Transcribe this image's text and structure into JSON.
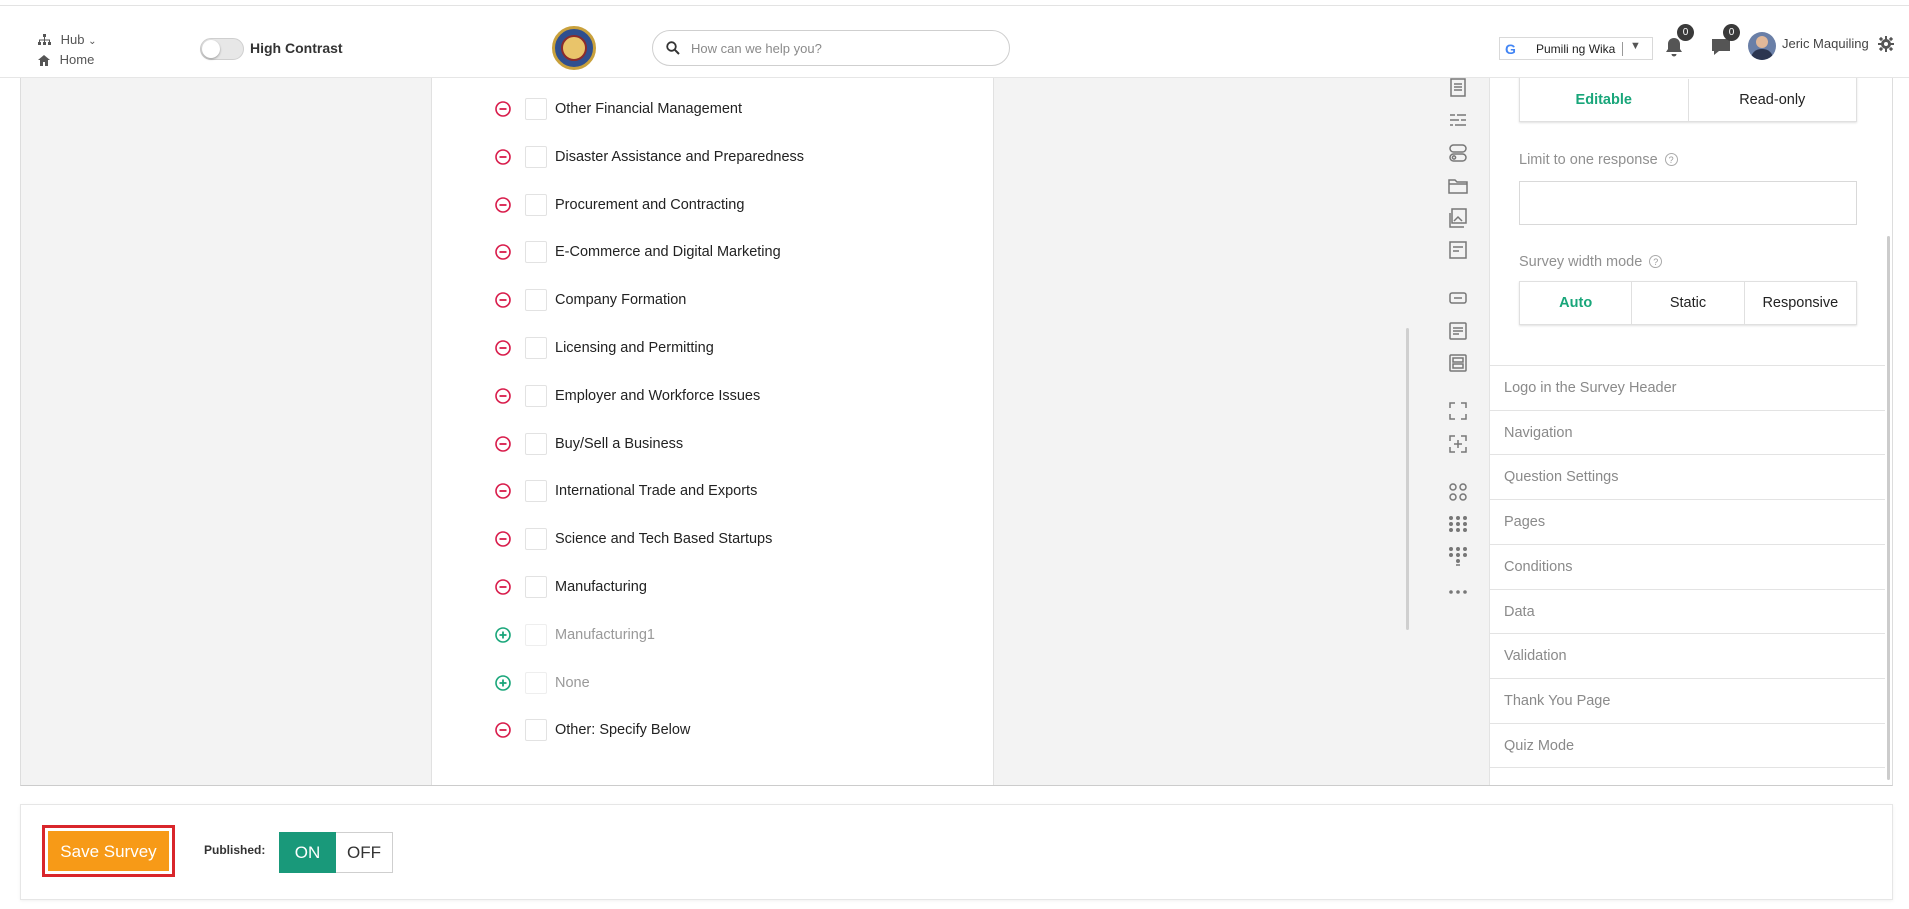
{
  "topbar": {
    "hub_label": "Hub",
    "home_label": "Home",
    "high_contrast_label": "High Contrast",
    "search_placeholder": "How can we help you?",
    "language_label": "Pumili ng Wika",
    "language_arrow": "▼",
    "notifications_count": "0",
    "messages_count": "0",
    "user_name": "Jeric Maquiling"
  },
  "choices": [
    {
      "label": "Other Financial Management",
      "state": "remove"
    },
    {
      "label": "Disaster Assistance and Preparedness",
      "state": "remove"
    },
    {
      "label": "Procurement and Contracting",
      "state": "remove"
    },
    {
      "label": "E-Commerce and Digital Marketing",
      "state": "remove"
    },
    {
      "label": "Company Formation",
      "state": "remove"
    },
    {
      "label": "Licensing and Permitting",
      "state": "remove"
    },
    {
      "label": "Employer and Workforce Issues",
      "state": "remove"
    },
    {
      "label": "Buy/Sell a Business",
      "state": "remove"
    },
    {
      "label": "International Trade and Exports",
      "state": "remove"
    },
    {
      "label": "Science and Tech Based Startups",
      "state": "remove"
    },
    {
      "label": "Manufacturing",
      "state": "remove"
    },
    {
      "label": "Manufacturing1",
      "state": "add"
    },
    {
      "label": "None",
      "state": "add"
    },
    {
      "label": "Other: Specify Below",
      "state": "remove"
    }
  ],
  "properties": {
    "mode_options": [
      "Editable",
      "Read-only"
    ],
    "mode_selected": "Editable",
    "limit_label": "Limit to one response",
    "limit_value": "",
    "width_mode_label": "Survey width mode",
    "width_mode_options": [
      "Auto",
      "Static",
      "Responsive"
    ],
    "width_mode_selected": "Auto",
    "sections": [
      "Logo in the Survey Header",
      "Navigation",
      "Question Settings",
      "Pages",
      "Conditions",
      "Data",
      "Validation",
      "Thank You Page",
      "Quiz Mode"
    ]
  },
  "footer": {
    "save_label": "Save Survey",
    "published_label": "Published:",
    "on_label": "ON",
    "off_label": "OFF",
    "published_state": "ON"
  },
  "colors": {
    "accent_green": "#19a67a",
    "remove_red": "#d81b4a",
    "save_orange": "#f79a17",
    "highlight_red": "#d9262b"
  }
}
